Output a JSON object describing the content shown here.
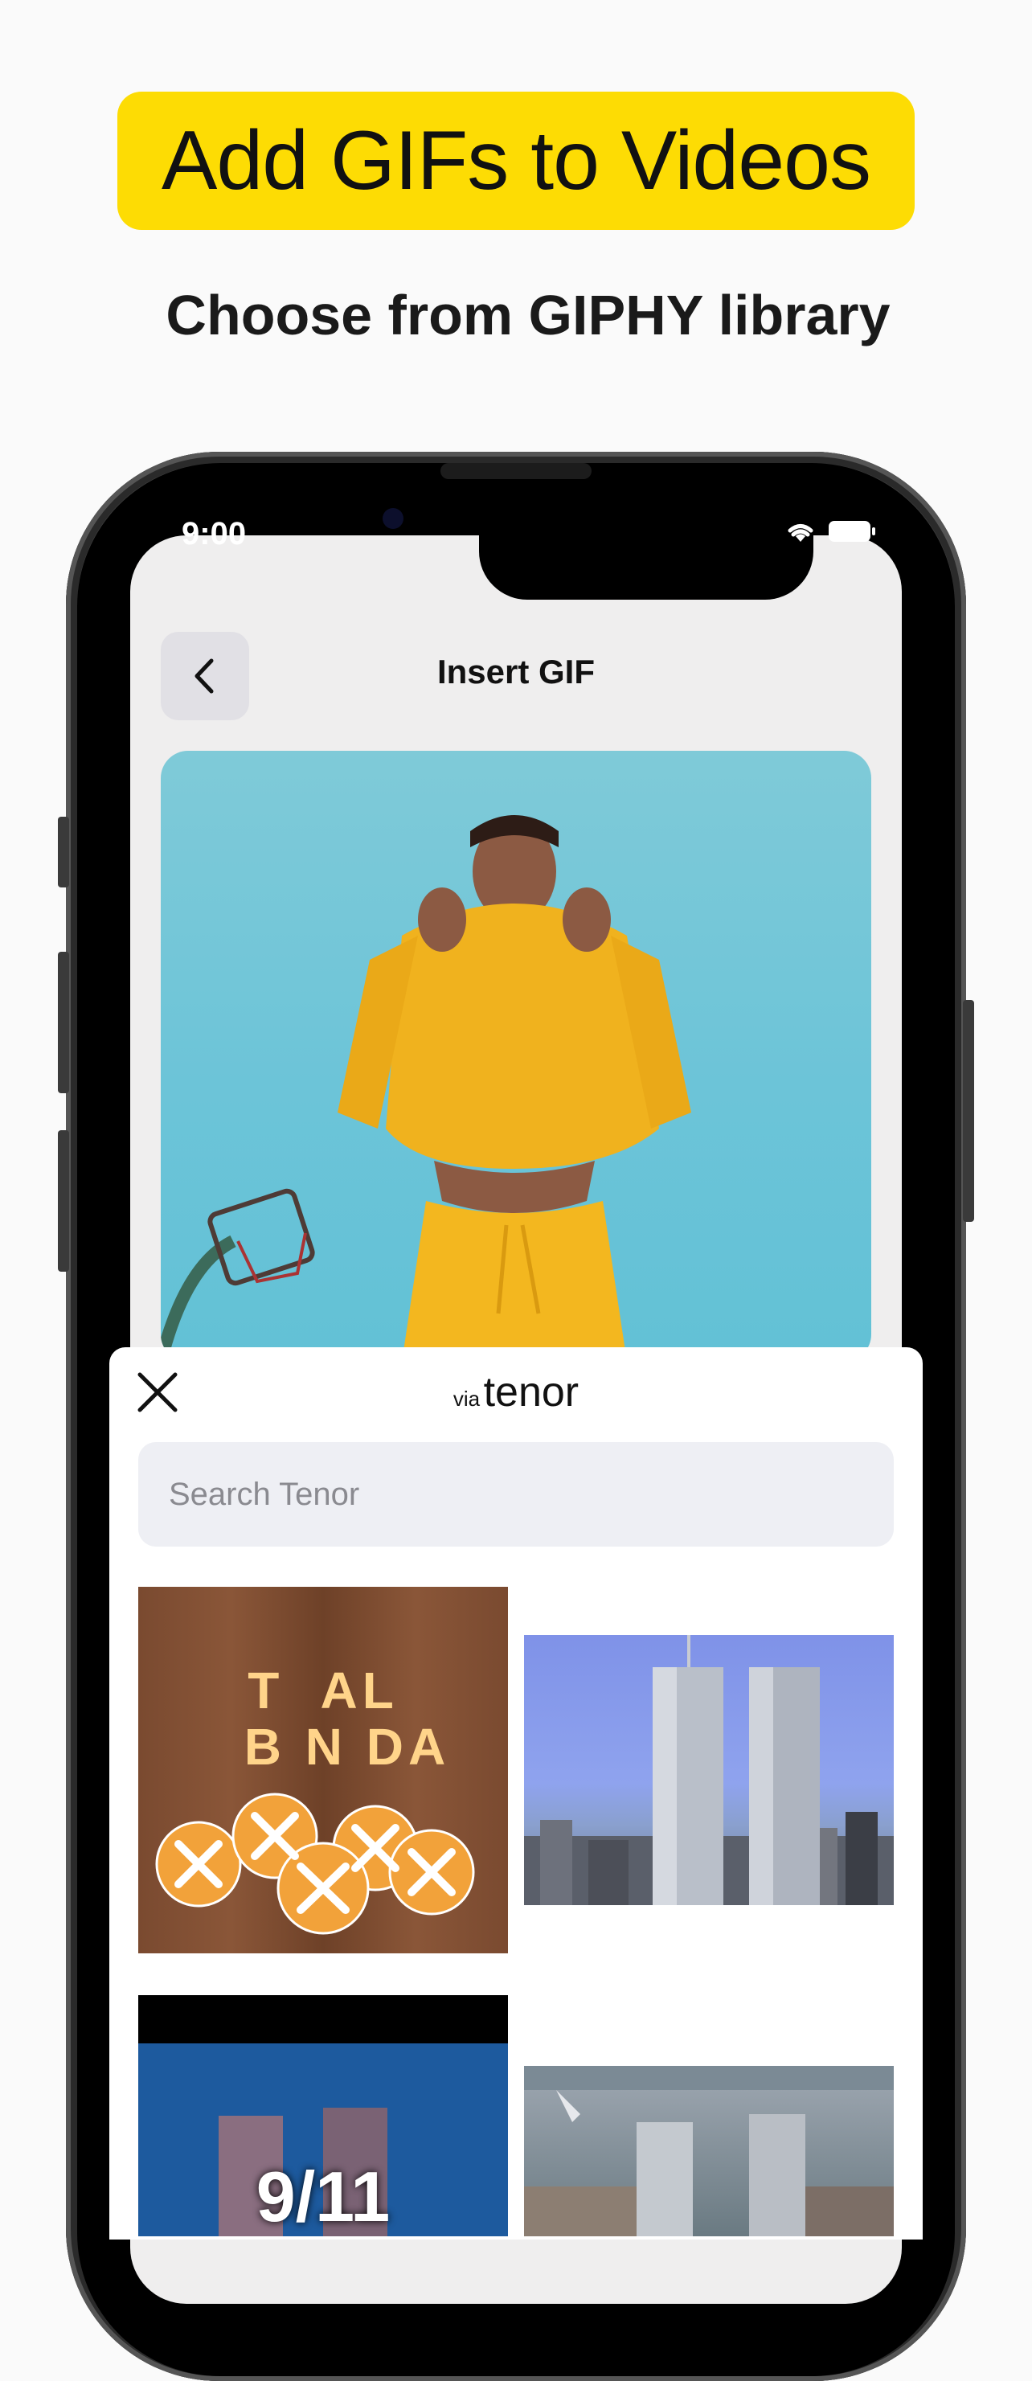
{
  "marketing": {
    "headline": "Add GIFs to Videos",
    "subheadline": "Choose from GIPHY library"
  },
  "status_bar": {
    "time": "9:00"
  },
  "nav": {
    "title": "Insert GIF"
  },
  "sheet": {
    "via_label": "via",
    "brand_label": "tenor",
    "search_placeholder": "Search Tenor"
  },
  "results": {
    "gif1_line1": "T  AL",
    "gif1_line2": "B N DA",
    "gif3_caption": "9/11"
  },
  "colors": {
    "accent_yellow": "#fddc04",
    "sheet_bg": "#ffffff",
    "search_bg": "#eeeff4",
    "app_bg": "#efeeee"
  }
}
